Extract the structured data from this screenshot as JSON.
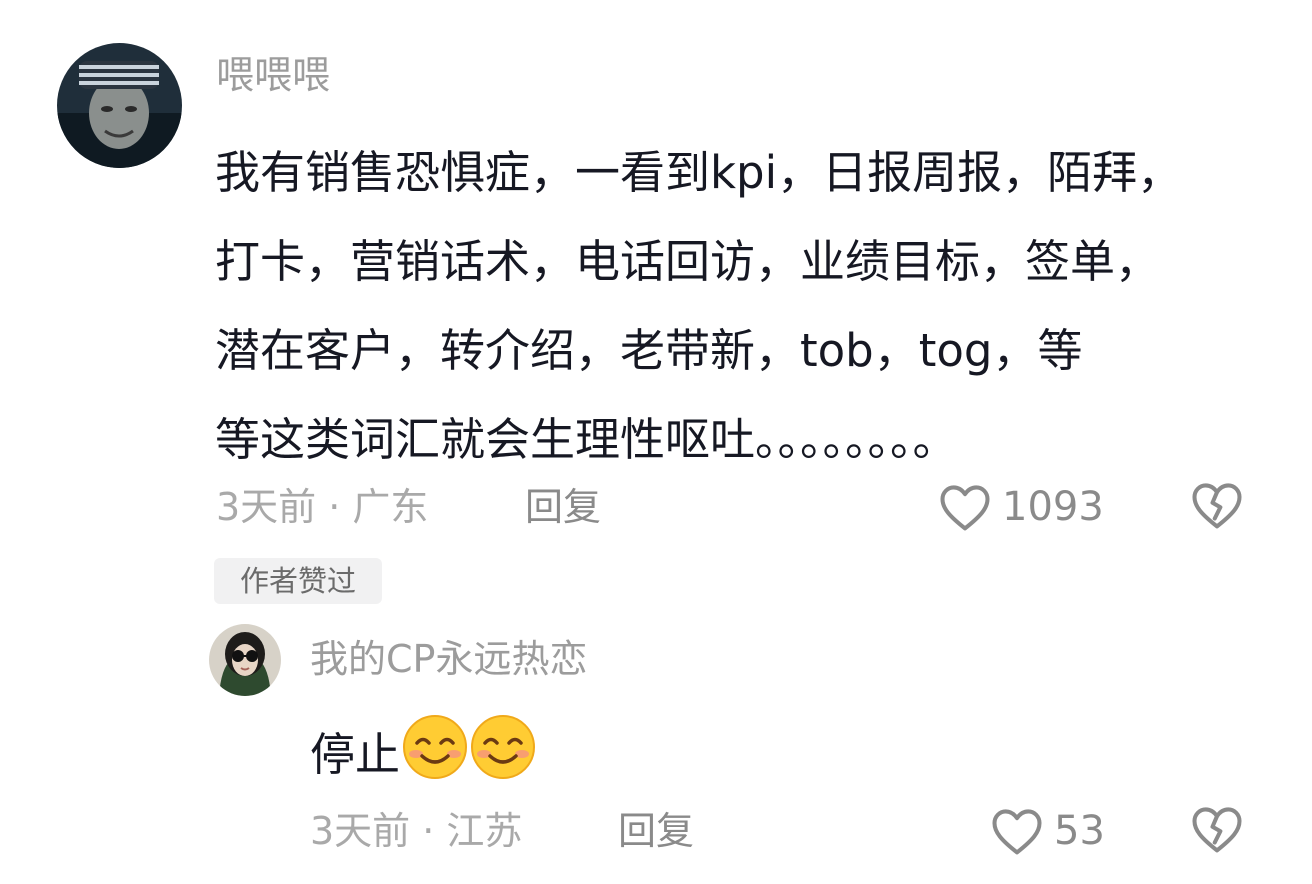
{
  "comment": {
    "username": "喂喂喂",
    "text": "我有销售恐惧症，一看到kpi，日报周报，陌拜，打卡，营销话术，电话回访，业绩目标，签单，潜在客户，转介绍，老带新，tob，tog，等等这类词汇就会生理性呕吐。。。。。。。。",
    "lines": [
      "我有销售恐惧症，一看到kpi，日报周报，陌拜，",
      "打卡，营销话术，电话回访，业绩目标，签单，",
      "潜在客户，转介绍，老带新，tob，tog，等",
      "等这类词汇就会生理性呕吐。。。。。。。。"
    ],
    "time_location": "3天前 · 广东",
    "reply_label": "回复",
    "like_count": "1093",
    "author_badge": "作者赞过",
    "icons": {
      "like": "heart-outline-icon",
      "dislike": "broken-heart-icon"
    }
  },
  "reply": {
    "username": "我的CP永远热恋",
    "text": "停止",
    "emojis": [
      "smiling-face-emoji",
      "smiling-face-emoji"
    ],
    "time_location": "3天前 · 江苏",
    "reply_label": "回复",
    "like_count": "53"
  },
  "colors": {
    "text": "#161823",
    "username": "#9c9c9c",
    "meta": "#a9a9a9",
    "badge_bg": "#f1f1f2"
  }
}
